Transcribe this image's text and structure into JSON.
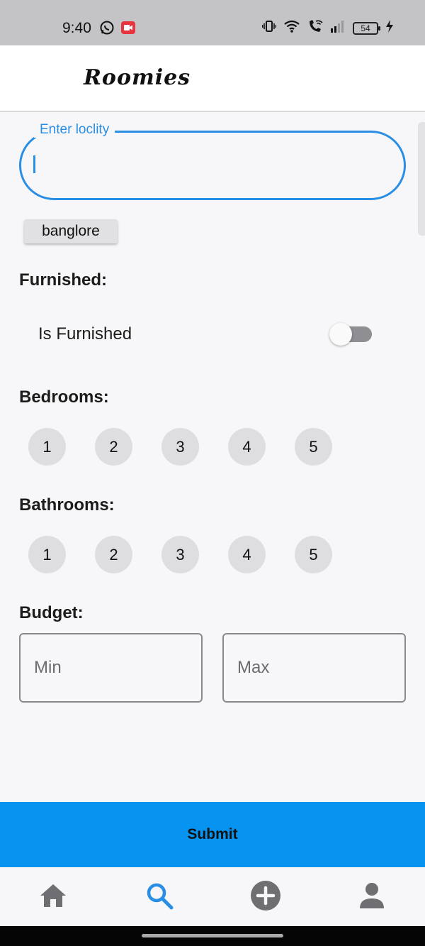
{
  "status_bar": {
    "time": "9:40",
    "battery_level": "54",
    "left_icons": [
      "whatsapp-icon",
      "video-record-icon"
    ],
    "right_icons": [
      "vibrate-icon",
      "wifi-icon",
      "wifi-call-icon",
      "signal-icon",
      "battery-icon",
      "charging-icon"
    ]
  },
  "app_bar": {
    "title": "Roomies"
  },
  "locality": {
    "label": "Enter loclity",
    "value": "",
    "suggestion_chip": "banglore"
  },
  "furnished": {
    "title": "Furnished:",
    "toggle_label": "Is Furnished",
    "toggle_on": false
  },
  "bedrooms": {
    "title": "Bedrooms:",
    "options": [
      "1",
      "2",
      "3",
      "4",
      "5"
    ]
  },
  "bathrooms": {
    "title": "Bathrooms:",
    "options": [
      "1",
      "2",
      "3",
      "4",
      "5"
    ]
  },
  "budget": {
    "title": "Budget:",
    "min_placeholder": "Min",
    "max_placeholder": "Max"
  },
  "submit": {
    "label": "Submit"
  },
  "bottom_nav": {
    "items": [
      {
        "icon": "home-icon",
        "active": false
      },
      {
        "icon": "search-icon",
        "active": true
      },
      {
        "icon": "add-icon",
        "active": false
      },
      {
        "icon": "profile-icon",
        "active": false
      }
    ]
  },
  "colors": {
    "accent": "#2a8fe4",
    "submit": "#0794f0",
    "inactive_icon": "#6e6e73"
  }
}
